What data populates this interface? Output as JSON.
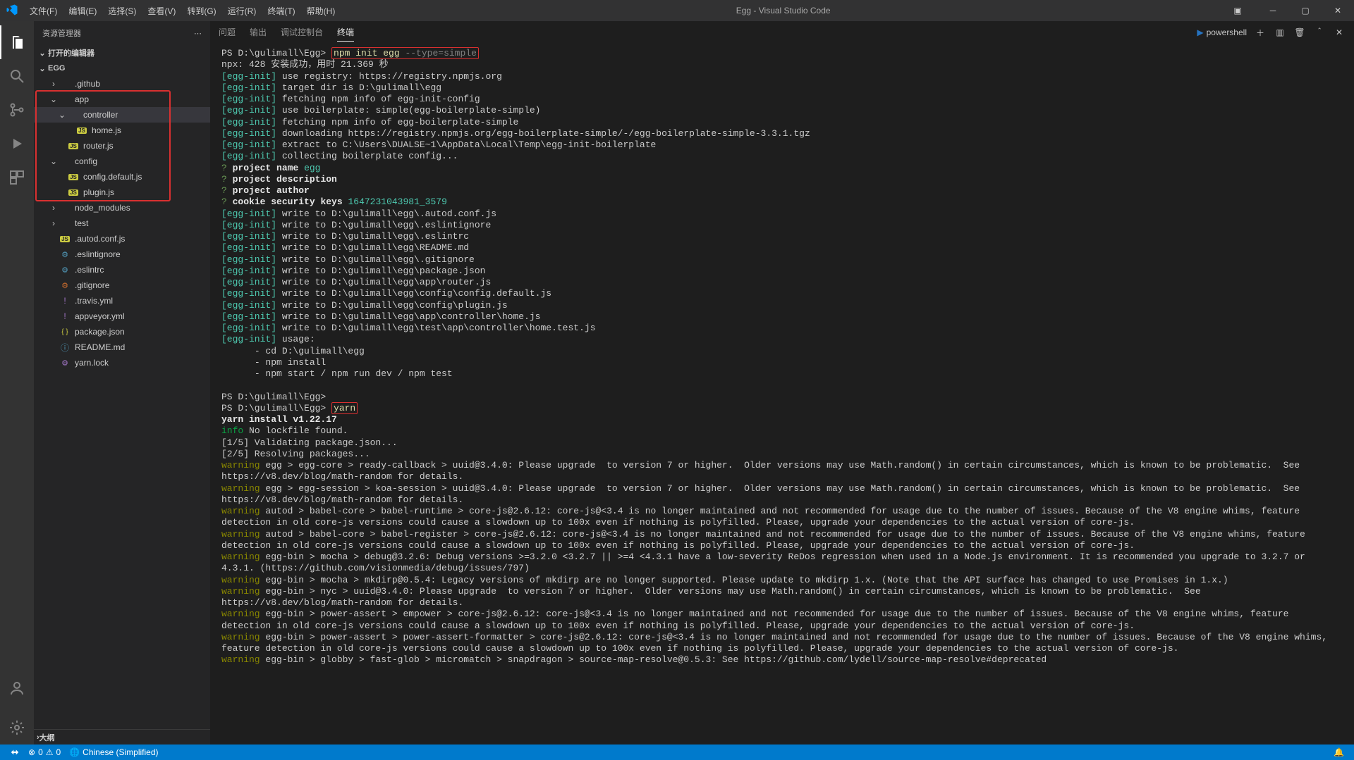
{
  "window_title": "Egg - Visual Studio Code",
  "menu": [
    "文件(F)",
    "编辑(E)",
    "选择(S)",
    "查看(V)",
    "转到(G)",
    "运行(R)",
    "终端(T)",
    "帮助(H)"
  ],
  "sidebar": {
    "title": "资源管理器",
    "open_editors": "打开的编辑器",
    "root": "EGG",
    "outline": "大纲",
    "tree": [
      {
        "indent": 1,
        "type": "folder",
        "label": ".github",
        "open": false
      },
      {
        "indent": 1,
        "type": "folder",
        "label": "app",
        "open": true,
        "boxed": true
      },
      {
        "indent": 2,
        "type": "folder",
        "label": "controller",
        "open": true,
        "selected": true,
        "boxed": true
      },
      {
        "indent": 3,
        "type": "file",
        "icon": "js",
        "label": "home.js",
        "boxed": true
      },
      {
        "indent": 2,
        "type": "file",
        "icon": "js",
        "label": "router.js",
        "boxed": true
      },
      {
        "indent": 1,
        "type": "folder",
        "label": "config",
        "open": true,
        "boxed": true
      },
      {
        "indent": 2,
        "type": "file",
        "icon": "js",
        "label": "config.default.js",
        "boxed": true
      },
      {
        "indent": 2,
        "type": "file",
        "icon": "js",
        "label": "plugin.js",
        "boxed": true
      },
      {
        "indent": 1,
        "type": "folder",
        "label": "node_modules",
        "open": false
      },
      {
        "indent": 1,
        "type": "folder",
        "label": "test",
        "open": false
      },
      {
        "indent": 1,
        "type": "file",
        "icon": "js",
        "label": ".autod.conf.js"
      },
      {
        "indent": 1,
        "type": "file",
        "icon": "dot",
        "label": ".eslintignore",
        "color": "#519aba"
      },
      {
        "indent": 1,
        "type": "file",
        "icon": "dot",
        "label": ".eslintrc",
        "color": "#519aba"
      },
      {
        "indent": 1,
        "type": "file",
        "icon": "dot",
        "label": ".gitignore",
        "color": "#cc6d2e"
      },
      {
        "indent": 1,
        "type": "file",
        "icon": "bang",
        "label": ".travis.yml",
        "color": "#a074c4"
      },
      {
        "indent": 1,
        "type": "file",
        "icon": "bang",
        "label": "appveyor.yml",
        "color": "#a074c4"
      },
      {
        "indent": 1,
        "type": "file",
        "icon": "json",
        "label": "package.json",
        "color": "#cbcb41"
      },
      {
        "indent": 1,
        "type": "file",
        "icon": "info",
        "label": "README.md",
        "color": "#519aba"
      },
      {
        "indent": 1,
        "type": "file",
        "icon": "dot",
        "label": "yarn.lock",
        "color": "#a074c4"
      }
    ]
  },
  "panel": {
    "tabs": [
      "问题",
      "输出",
      "调试控制台",
      "终端"
    ],
    "active_tab": "终端",
    "terminal_kind": "powershell"
  },
  "terminal": {
    "prompt1": "PS D:\\gulimall\\Egg>",
    "cmd1_a": "npm init egg",
    "cmd1_b": " --type=simple",
    "line_npx": "npx: 428 安装成功，用时 21.369 秒",
    "egg_init_tag": "[egg-init]",
    "egg_lines": [
      "use registry: https://registry.npmjs.org",
      "target dir is D:\\gulimall\\egg",
      "fetching npm info of egg-init-config",
      "use boilerplate: simple(egg-boilerplate-simple)",
      "fetching npm info of egg-boilerplate-simple",
      "downloading https://registry.npmjs.org/egg-boilerplate-simple/-/egg-boilerplate-simple-3.3.1.tgz",
      "extract to C:\\Users\\DUALSE~1\\AppData\\Local\\Temp\\egg-init-boilerplate",
      "collecting boilerplate config..."
    ],
    "questions": {
      "pname_label": "project name",
      "pname_value": "egg",
      "pdesc_label": "project description",
      "pauthor_label": "project author",
      "cookie_label": "cookie security keys",
      "cookie_value": "1647231043981_3579"
    },
    "write_lines": [
      "write to D:\\gulimall\\egg\\.autod.conf.js",
      "write to D:\\gulimall\\egg\\.eslintignore",
      "write to D:\\gulimall\\egg\\.eslintrc",
      "write to D:\\gulimall\\egg\\README.md",
      "write to D:\\gulimall\\egg\\.gitignore",
      "write to D:\\gulimall\\egg\\package.json",
      "write to D:\\gulimall\\egg\\app\\router.js",
      "write to D:\\gulimall\\egg\\config\\config.default.js",
      "write to D:\\gulimall\\egg\\config\\plugin.js",
      "write to D:\\gulimall\\egg\\app\\controller\\home.js",
      "write to D:\\gulimall\\egg\\test\\app\\controller\\home.test.js"
    ],
    "usage_label": "usage:",
    "usage_lines": [
      "- cd D:\\gulimall\\egg",
      "- npm install",
      "- npm start / npm run dev / npm test"
    ],
    "prompt2": "PS D:\\gulimall\\Egg>",
    "prompt3": "PS D:\\gulimall\\Egg>",
    "cmd2": "yarn",
    "yarn_install": "yarn install v1.22.17",
    "info_label": "info",
    "info_text": "No lockfile found.",
    "steps": [
      "[1/5] Validating package.json...",
      "[2/5] Resolving packages..."
    ],
    "warning_label": "warning",
    "warnings": [
      "egg > egg-core > ready-callback > uuid@3.4.0: Please upgrade  to version 7 or higher.  Older versions may use Math.random() in certain circumstances, which is known to be problematic.  See https://v8.dev/blog/math-random for details.",
      "egg > egg-session > koa-session > uuid@3.4.0: Please upgrade  to version 7 or higher.  Older versions may use Math.random() in certain circumstances, which is known to be problematic.  See https://v8.dev/blog/math-random for details.",
      "autod > babel-core > babel-runtime > core-js@2.6.12: core-js@<3.4 is no longer maintained and not recommended for usage due to the number of issues. Because of the V8 engine whims, feature detection in old core-js versions could cause a slowdown up to 100x even if nothing is polyfilled. Please, upgrade your dependencies to the actual version of core-js.",
      "autod > babel-core > babel-register > core-js@2.6.12: core-js@<3.4 is no longer maintained and not recommended for usage due to the number of issues. Because of the V8 engine whims, feature detection in old core-js versions could cause a slowdown up to 100x even if nothing is polyfilled. Please, upgrade your dependencies to the actual version of core-js.",
      "egg-bin > mocha > debug@3.2.6: Debug versions >=3.2.0 <3.2.7 || >=4 <4.3.1 have a low-severity ReDos regression when used in a Node.js environment. It is recommended you upgrade to 3.2.7 or 4.3.1. (https://github.com/visionmedia/debug/issues/797)",
      "egg-bin > mocha > mkdirp@0.5.4: Legacy versions of mkdirp are no longer supported. Please update to mkdirp 1.x. (Note that the API surface has changed to use Promises in 1.x.)",
      "egg-bin > nyc > uuid@3.4.0: Please upgrade  to version 7 or higher.  Older versions may use Math.random() in certain circumstances, which is known to be problematic.  See https://v8.dev/blog/math-random for details.",
      "egg-bin > power-assert > empower > core-js@2.6.12: core-js@<3.4 is no longer maintained and not recommended for usage due to the number of issues. Because of the V8 engine whims, feature detection in old core-js versions could cause a slowdown up to 100x even if nothing is polyfilled. Please, upgrade your dependencies to the actual version of core-js.",
      "egg-bin > power-assert > power-assert-formatter > core-js@2.6.12: core-js@<3.4 is no longer maintained and not recommended for usage due to the number of issues. Because of the V8 engine whims, feature detection in old core-js versions could cause a slowdown up to 100x even if nothing is polyfilled. Please, upgrade your dependencies to the actual version of core-js.",
      "egg-bin > globby > fast-glob > micromatch > snapdragon > source-map-resolve@0.5.3: See https://github.com/lydell/source-map-resolve#deprecated"
    ]
  },
  "status": {
    "errors": "0",
    "warnings": "0",
    "language": "Chinese (Simplified)",
    "bell": "🔔"
  }
}
